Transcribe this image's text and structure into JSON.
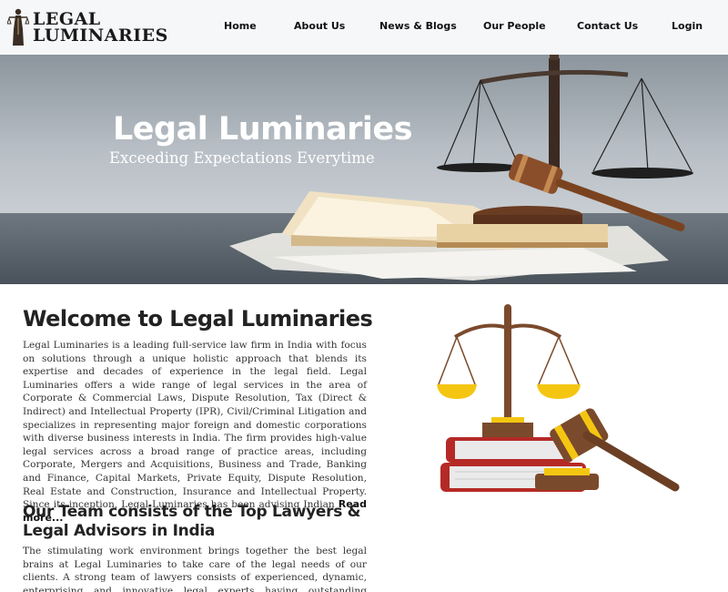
{
  "logo": {
    "line1": "LEGAL",
    "line2": "LUMINARIES"
  },
  "nav": [
    "Home",
    "About Us",
    "News & Blogs",
    "Our People",
    "Contact Us",
    "Login"
  ],
  "hero": {
    "title": "Legal Luminaries",
    "subtitle": "Exceeding Expectations Everytime"
  },
  "welcome": {
    "title": "Welcome to Legal Luminaries",
    "body": "Legal Luminaries is a leading full-service law firm in India with focus on solutions through a unique holistic approach that blends its expertise and decades of experience in the legal field. Legal Luminaries offers a wide range of legal services in the area of Corporate & Commercial Laws, Dispute Resolution, Tax (Direct & Indirect) and Intellectual Property (IPR), Civil/Criminal Litigation and specializes in representing major foreign and domestic corporations with diverse business interests in India. The firm provides high-value legal services across a broad range of practice areas, including Corporate, Mergers and Acquisitions, Business and Trade, Banking and Finance, Capital Markets, Private Equity, Dispute Resolution, Real Estate and Construction, Insurance and Intellectual Property. Since its inception, Legal Luminaries has been advising Indian",
    "read_more": "Read more..."
  },
  "team": {
    "title": "Our Team consists of the Top Lawyers & Legal Advisors in India",
    "body": "The stimulating work environment brings together the best legal brains at Legal Luminaries to take care of the legal needs of our clients. A strong team of lawyers consists of experienced, dynamic, enterprising and innovative legal experts having outstanding academic and professional records. Under"
  },
  "icons": [
    "scales-of-justice-icon",
    "gavel-icon",
    "law-books-icon"
  ]
}
